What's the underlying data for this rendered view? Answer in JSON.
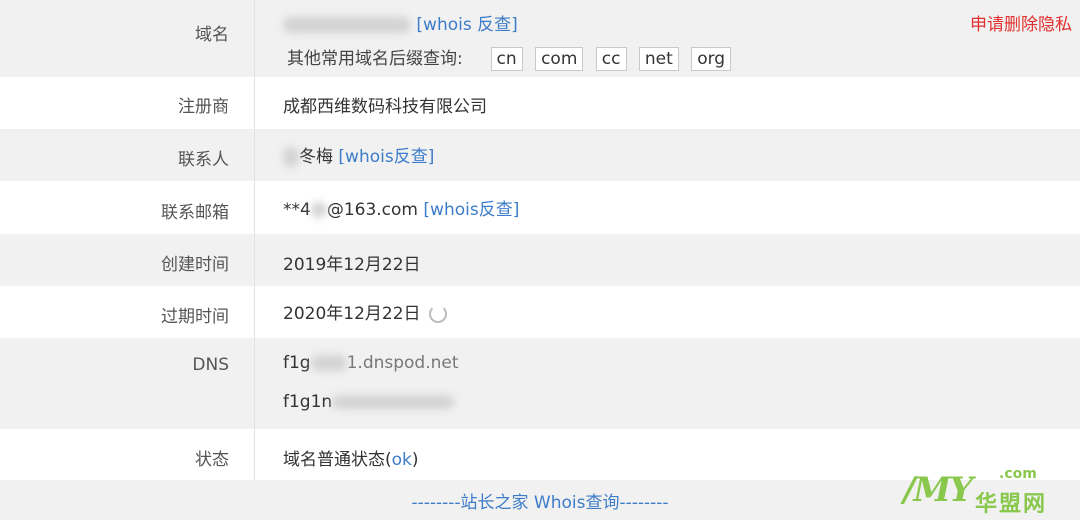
{
  "domain": {
    "label": "域名",
    "whois_link": "[whois 反查]",
    "delete_privacy": "申请删除隐私",
    "suffix_label": "其他常用域名后缀查询:",
    "suffixes": [
      "cn",
      "com",
      "cc",
      "net",
      "org"
    ]
  },
  "registrar": {
    "label": "注册商",
    "value": "成都西维数码科技有限公司"
  },
  "contact": {
    "label": "联系人",
    "value": "冬梅",
    "whois_link": "[whois反查]"
  },
  "email": {
    "label": "联系邮箱",
    "value_prefix": "**4",
    "value_suffix": "@163.com",
    "whois_link": "[whois反查]"
  },
  "created": {
    "label": "创建时间",
    "value": "2019年12月22日"
  },
  "expires": {
    "label": "过期时间",
    "value": "2020年12月22日"
  },
  "dns": {
    "label": "DNS",
    "ns1_prefix": "f1g",
    "ns1_suffix": "1.dnspod.net",
    "ns2_prefix": "f1g1n"
  },
  "status": {
    "label": "状态",
    "value_prefix": "域名普通状态(",
    "value_link": "ok",
    "value_suffix": ")"
  },
  "footer": {
    "text": "--------站长之家 Whois查询--------"
  },
  "watermark": {
    "logo": "/MY",
    "dotcom": ".com",
    "cn_text": "华盟网"
  },
  "colors": {
    "link": "#3d7cc9",
    "red": "#e3302f",
    "gray_row": "#f1f1f1",
    "watermark": "#8ac84d"
  }
}
